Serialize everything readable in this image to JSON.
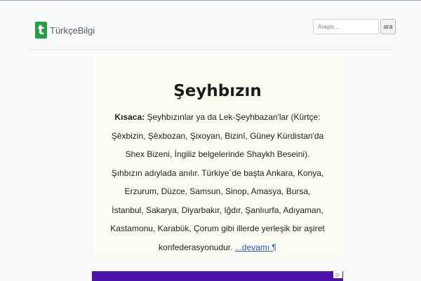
{
  "header": {
    "brand_logo": "t",
    "brand_name": "TürkçeBilgi",
    "search_placeholder": "Araştır...",
    "search_button": "ara"
  },
  "article": {
    "title": "Şeyhbızın",
    "lead": "Kısaca:",
    "body": " Şeyhbızınlar ya da Lek-Şeyhbazan'lar (Kürtçe: Şêxbizin, Şêxbozan, Şixoyan, Bizinî, Güney Kürdistan'da Shex Bizeni, İngiliz belgelerinde Shaykh Beseini). Şıhbızın adıylada anılır. Türkiye´de başta Ankara, Konya, Erzurum, Düzce, Samsun, Sinop, Amasya, Bursa, İstanbul, Sakarya, Diyarbakır, Iğdır, Şanlıurfa, Adıyaman, Kastamonu, Karabük, Çorum gibi illerde yerleşik bir aşiret konfederasyonudur. ",
    "more_link": "...devamı ¶"
  },
  "ad": {
    "icon_name": "ad-choices-icon",
    "color": "#4a12a8"
  },
  "colors": {
    "brand": "#21a044",
    "card_background": "#fcfcf2",
    "link": "#1a5bd1"
  }
}
